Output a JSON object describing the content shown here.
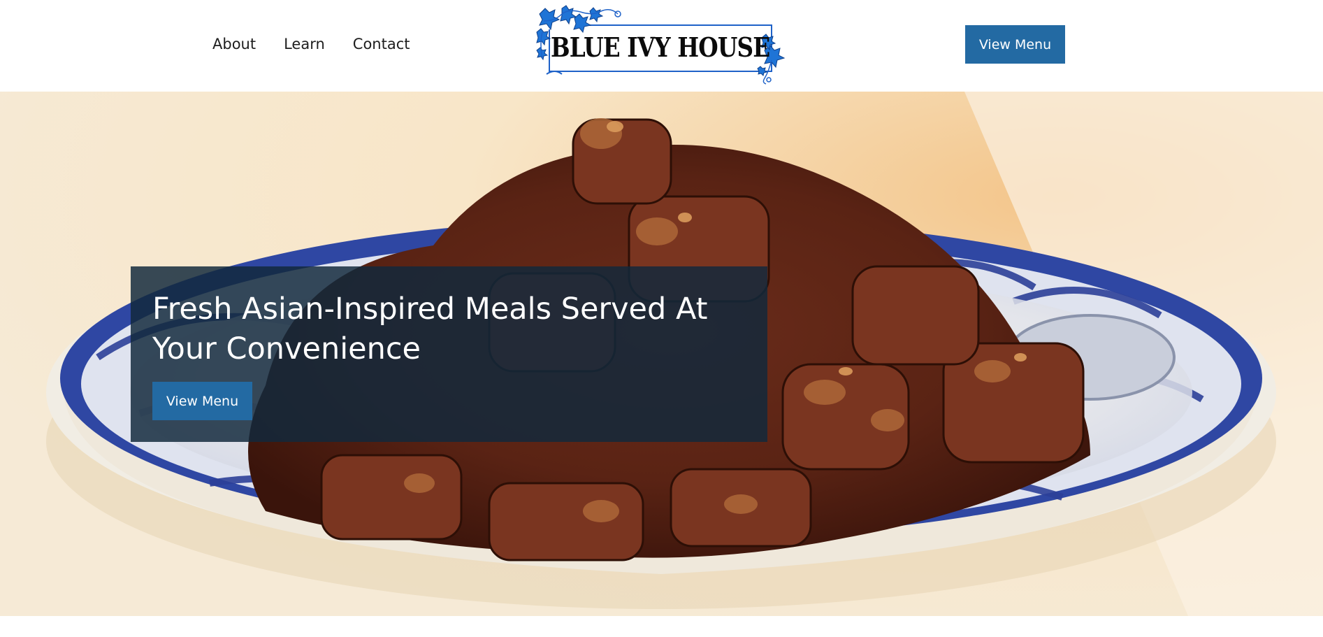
{
  "nav": {
    "items": [
      {
        "label": "About"
      },
      {
        "label": "Learn"
      },
      {
        "label": "Contact"
      }
    ]
  },
  "logo": {
    "text": "BLUE IVY HOUSE",
    "icon": "ivy-leaves-logo-icon"
  },
  "header": {
    "cta_label": "View Menu"
  },
  "hero": {
    "image": "food-plate-hero-image",
    "title": "Fresh Asian-Inspired Meals Served At Your Convenience",
    "cta_label": "View Menu"
  },
  "colors": {
    "accent": "#236aa3",
    "overlay": "#12283c",
    "logo_blue": "#1f74d6",
    "text_dark": "#1e1e1e"
  }
}
